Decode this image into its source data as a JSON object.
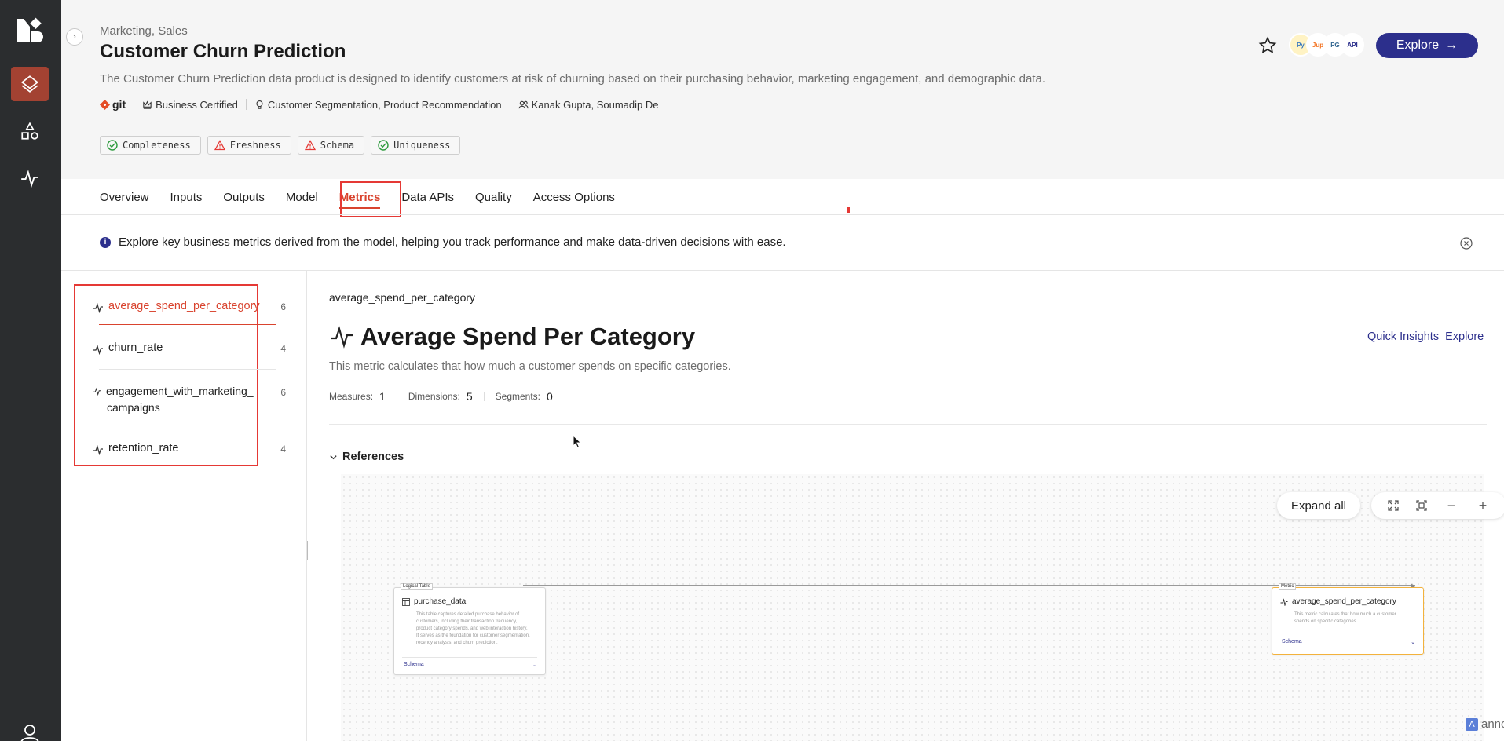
{
  "header": {
    "domain": "Marketing, Sales",
    "title": "Customer Churn Prediction",
    "description": "The Customer Churn Prediction data product is designed to identify customers at risk of churning based on their purchasing behavior, marketing engagement, and demographic data.",
    "git_label": "git",
    "certification": "Business Certified",
    "use_cases": "Customer Segmentation, Product Recommendation",
    "owners": "Kanak Gupta, Soumadip De",
    "explore_label": "Explore",
    "quality_badges": [
      {
        "label": "Completeness",
        "status": "pass"
      },
      {
        "label": "Freshness",
        "status": "warn"
      },
      {
        "label": "Schema",
        "status": "warn"
      },
      {
        "label": "Uniqueness",
        "status": "pass"
      }
    ],
    "avatars": [
      "python",
      "jupyter",
      "postgres",
      "api"
    ]
  },
  "tabs": [
    "Overview",
    "Inputs",
    "Outputs",
    "Model",
    "Metrics",
    "Data APIs",
    "Quality",
    "Access Options"
  ],
  "active_tab": "Metrics",
  "info_banner": "Explore key business metrics derived from the model, helping you track performance and make data-driven decisions with ease.",
  "metrics": [
    {
      "name": "average_spend_per_category",
      "count": "6",
      "active": true
    },
    {
      "name": "churn_rate",
      "count": "4"
    },
    {
      "name": "engagement_with_marketing_campaigns",
      "name_line1": "engagement_with_marketing_",
      "name_line2": "campaigns",
      "count": "6"
    },
    {
      "name": "retention_rate",
      "count": "4"
    }
  ],
  "detail": {
    "breadcrumb": "average_spend_per_category",
    "title": "Average Spend Per Category",
    "description": "This metric calculates that how much a customer spends on specific categories.",
    "measures_label": "Measures:",
    "measures": "1",
    "dimensions_label": "Dimensions:",
    "dimensions": "5",
    "segments_label": "Segments:",
    "segments": "0",
    "quick_insights": "Quick Insights",
    "explore": "Explore",
    "references_label": "References"
  },
  "canvas": {
    "expand_all": "Expand all",
    "source_node": {
      "tag": "Logical Table",
      "title": "purchase_data",
      "desc_lines": [
        "This table captures detailed purchase behavior of",
        "customers, including their transaction frequency,",
        "product category spends, and web interaction history.",
        "It serves as the foundation for customer segmentation,",
        "recency analysis, and churn prediction."
      ],
      "footer": "Schema"
    },
    "target_node": {
      "tag": "Metric",
      "title": "average_spend_per_category",
      "desc_lines": [
        "This metric calculates that how much a customer",
        "spends on specific categories."
      ],
      "footer": "Schema"
    }
  },
  "watermark": "annotely.com",
  "colors": {
    "accent": "#d9432e",
    "primary": "#2c2f8c",
    "rail": "#2b2d2f",
    "rail_active": "#a34232",
    "highlight": "#e53935"
  }
}
